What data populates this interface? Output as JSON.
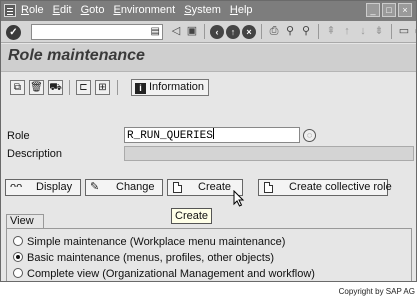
{
  "menu": {
    "items": [
      "Role",
      "Edit",
      "Goto",
      "Environment",
      "System",
      "Help"
    ]
  },
  "window_controls": [
    "minimize-icon",
    "maximize-icon",
    "close-icon"
  ],
  "toolbar": {
    "command_field_value": "",
    "icons": [
      "back-icon",
      "exit-icon",
      "cancel-icon",
      "print-icon",
      "find-icon",
      "find-next-icon",
      "first-page-icon",
      "previous-page-icon",
      "next-page-icon",
      "last-page-icon"
    ]
  },
  "page": {
    "title": "Role maintenance"
  },
  "app_toolbar": {
    "info_label": "Information"
  },
  "form": {
    "role_label": "Role",
    "role_value": "R_RUN_QUERIES",
    "description_label": "Description",
    "description_value": ""
  },
  "actions": {
    "display": "Display",
    "change": "Change",
    "create": "Create",
    "create_collective": "Create collective role"
  },
  "tooltip": "Create",
  "view": {
    "label": "View",
    "options": [
      {
        "label": "Simple maintenance (Workplace menu maintenance)",
        "selected": false
      },
      {
        "label": "Basic maintenance (menus, profiles, other objects)",
        "selected": true
      },
      {
        "label": "Complete view (Organizational Management and workflow)",
        "selected": false
      }
    ]
  },
  "copyright": "Copyright by SAP AG"
}
